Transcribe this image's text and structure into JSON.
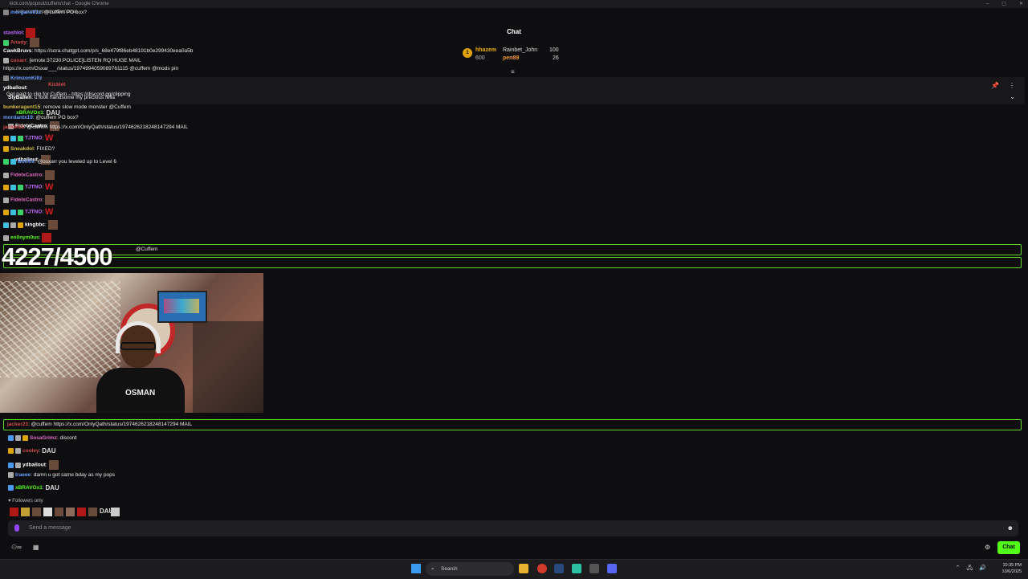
{
  "window": {
    "title": "kick.com/popout/cuffem/chat - Google Chrome",
    "address": "kick.com/popout/cuffem/chat",
    "controls": [
      "–",
      "▢",
      "✕"
    ]
  },
  "header": {
    "title": "Chat"
  },
  "leaderboard": {
    "rank": "1",
    "first": {
      "name": "hhazem",
      "amount": "600"
    },
    "second": {
      "name": "Rainbet_John",
      "amount": "100",
      "name2": "pen89",
      "amount2": "26"
    }
  },
  "pinned": {
    "username": "Kicklet",
    "text": "Get paid to clip for Cuffem - https://discord.gg/clipping"
  },
  "messages_top": [
    {
      "user": "morganstl1z",
      "text": "@cuffem PO box?"
    },
    {
      "user": "stashlol",
      "text": ""
    },
    {
      "user": "Anady",
      "text": ""
    },
    {
      "user": "CawkBruvs",
      "text": "https://sora.chatgpt.com/p/s_68e479f86eb48191b0e299430eea0a5b"
    },
    {
      "user": "cuxarr",
      "text": "[emote:37230:POLICE]LISTEN RQ HUGE MAIL"
    },
    {
      "user": "",
      "text": "https://x.com/Osxar___/status/1974994059089761115 @cuffem @mods pin"
    },
    {
      "user": "KrimzonKillz",
      "text": ""
    },
    {
      "user": "ydballout",
      "text": ""
    },
    {
      "user": "SlyBallen",
      "text": "u look handsome my precious fella"
    },
    {
      "user": "bunkeragent15",
      "text": "remove slow mode monster @Cuffem"
    },
    {
      "user": "xBRAVOx1",
      "text": ""
    },
    {
      "user": "mordantx19",
      "text": "@cuffem PO box?"
    },
    {
      "user": "FidelxCastro",
      "text": ""
    },
    {
      "user": "jacker23",
      "text": "@cuffem https://x.com/OnlyQath/status/1974626218248147294 MAIL"
    },
    {
      "user": "TJTNO",
      "text": ""
    },
    {
      "user": "Sneakdol",
      "text": "FIXED?"
    },
    {
      "user": "ydballout",
      "text": ""
    },
    {
      "user": "BotRix",
      "text": "@osxarr you leveled up to Level 6"
    },
    {
      "user": "FidelxCastro",
      "text": ""
    },
    {
      "user": "TJTNO",
      "text": ""
    },
    {
      "user": "FidelxCastro",
      "text": ""
    },
    {
      "user": "TJTNO",
      "text": ""
    },
    {
      "user": "kingbbc",
      "text": ""
    },
    {
      "user": "en0nym0us",
      "text": ""
    }
  ],
  "highlight1": {
    "text": "@Cuffem"
  },
  "counter": "4227/4500",
  "highlight2": {
    "user": "jacker23",
    "text": "@cuffem https://x.com/OnlyQath/status/1974626218248147294 MAIL"
  },
  "messages_bottom": [
    {
      "user": "SosaGrimz",
      "text": "discord"
    },
    {
      "user": "cooley",
      "text": ""
    },
    {
      "user": "ydballout",
      "text": ""
    },
    {
      "user": "traeee",
      "text": "damn u got same bday as my pops"
    },
    {
      "user": "xBRAVOx1",
      "text": ""
    }
  ],
  "followers_only": "Followers only",
  "input": {
    "placeholder": "Send a message"
  },
  "bottom": {
    "chat_button": "Chat"
  },
  "taskbar": {
    "search": "Search",
    "time": "10:35 PM",
    "date": "10/6/2025"
  },
  "colors": {
    "accent": "#53fc18",
    "background": "#0e0e10"
  }
}
